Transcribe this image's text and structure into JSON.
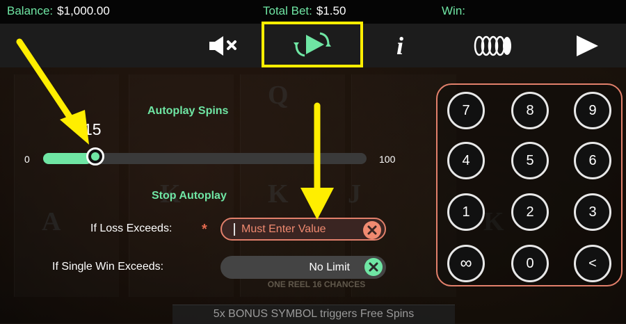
{
  "status_bar": {
    "balance_label": "Balance:",
    "balance_value": "$1,000.00",
    "total_bet_label": "Total Bet:",
    "total_bet_value": "$1.50",
    "win_label": "Win:"
  },
  "toolbar": {
    "buttons": [
      {
        "name": "mute",
        "icon": "speaker-muted-icon"
      },
      {
        "name": "autoplay",
        "icon": "autoplay-icon",
        "selected": true
      },
      {
        "name": "info",
        "icon": "info-icon",
        "glyph": "i"
      },
      {
        "name": "bet",
        "icon": "chip-stack-icon"
      },
      {
        "name": "spin",
        "icon": "play-icon"
      }
    ]
  },
  "autoplay": {
    "spins_heading": "Autoplay Spins",
    "slider": {
      "value": "15",
      "min_label": "0",
      "max_label": "100",
      "fraction": 0.15
    },
    "stop_heading": "Stop Autoplay",
    "loss_label": "If Loss Exceeds:",
    "required_marker": "*",
    "loss_placeholder": "Must Enter Value",
    "single_win_label": "If Single Win Exceeds:",
    "single_win_value": "No Limit"
  },
  "keypad": {
    "keys": [
      "7",
      "8",
      "9",
      "4",
      "5",
      "6",
      "1",
      "2",
      "3",
      "∞",
      "0",
      "<"
    ]
  },
  "game": {
    "reel_caption": "ONE REEL 16 CHANCES",
    "banner": "5x BONUS SYMBOL triggers Free Spins"
  },
  "colors": {
    "accent_green": "#6fe6a4",
    "highlight_yellow": "#ffee00",
    "error_coral": "#e2806b"
  }
}
